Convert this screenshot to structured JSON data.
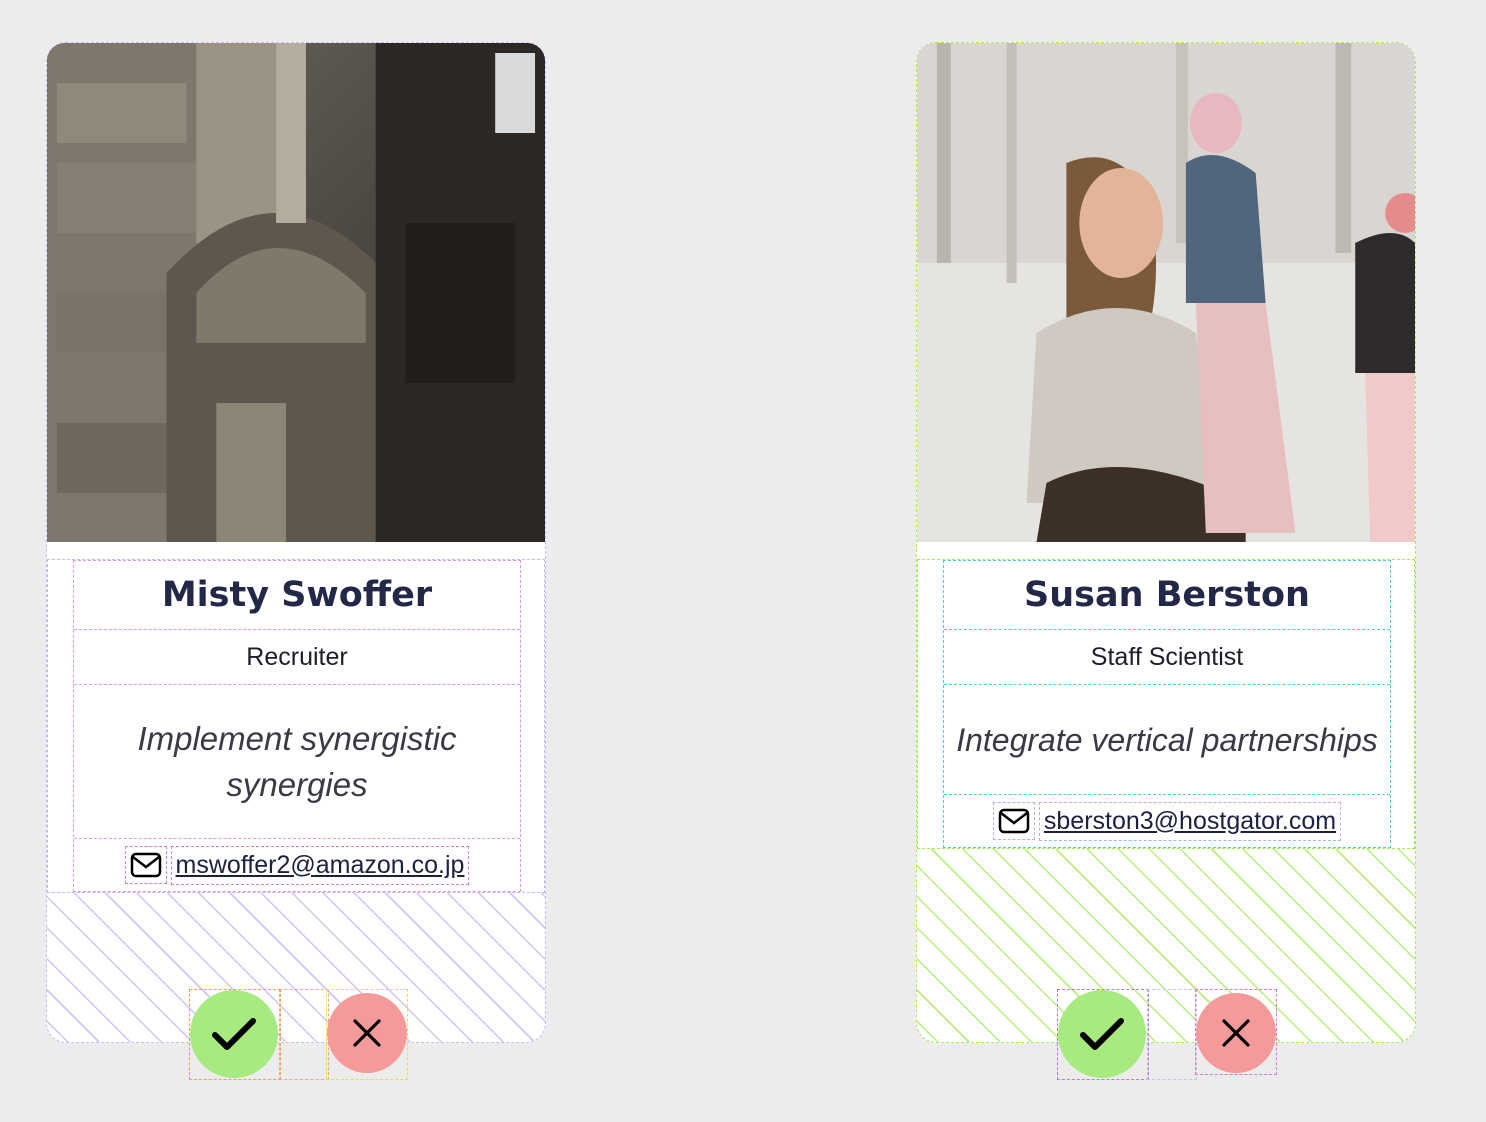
{
  "cards": [
    {
      "name": "Misty Swoffer",
      "role": "Recruiter",
      "tagline": "Implement synergistic synergies",
      "email": "mswoffer2@amazon.co.jp",
      "photo": "ornate-stone-building",
      "accent_color": "#c6b8f5",
      "accept_icon": "check-icon",
      "reject_icon": "close-icon"
    },
    {
      "name": "Susan Berston",
      "role": "Staff Scientist",
      "tagline": "Integrate vertical partnerships",
      "email": "sberston3@hostgator.com",
      "photo": "woman-and-children-in-snow",
      "accent_color": "#a6ea5a",
      "accept_icon": "check-icon",
      "reject_icon": "close-icon"
    }
  ],
  "colors": {
    "background": "#ececec",
    "accept_button": "#a6ea80",
    "reject_button": "#f59a9a",
    "name_text": "#232748"
  }
}
